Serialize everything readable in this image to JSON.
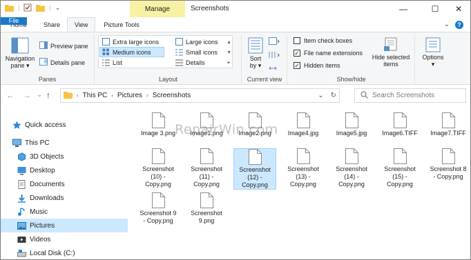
{
  "window": {
    "title": "Screenshots",
    "contextual_tab_group": "Manage",
    "controls": {
      "minimize": "—",
      "maximize": "☐",
      "close": "✕"
    }
  },
  "tabs": [
    {
      "label": "File"
    },
    {
      "label": "Home"
    },
    {
      "label": "Share"
    },
    {
      "label": "View"
    },
    {
      "label": "Picture Tools"
    }
  ],
  "tab_right": {
    "expand": "⌄",
    "help": "?"
  },
  "ribbon": {
    "panes": {
      "label": "Panes",
      "navigation_pane_line1": "Navigation",
      "navigation_pane_line2": "pane ▾",
      "preview_pane": "Preview pane",
      "details_pane": "Details pane"
    },
    "layout": {
      "label": "Layout",
      "items": [
        {
          "label": "Extra large icons"
        },
        {
          "label": "Large icons"
        },
        {
          "label": "Medium icons"
        },
        {
          "label": "Small icons"
        },
        {
          "label": "List"
        },
        {
          "label": "Details"
        }
      ]
    },
    "current_view": {
      "label": "Current view",
      "sort_line1": "Sort",
      "sort_line2": "by ▾"
    },
    "show_hide": {
      "label": "Show/hide",
      "item_check_boxes": {
        "label": "Item check boxes",
        "checked": false
      },
      "file_name_extensions": {
        "label": "File name extensions",
        "checked": true
      },
      "hidden_items": {
        "label": "Hidden items",
        "checked": true
      },
      "hide_selected_line1": "Hide selected",
      "hide_selected_line2": "items"
    },
    "options": {
      "label": "Options",
      "caret": "▾"
    }
  },
  "address": {
    "back": "←",
    "forward": "→",
    "down": "⌄",
    "up": "↑",
    "crumbs": [
      "This PC",
      "Pictures",
      "Screenshots"
    ],
    "separator": "›",
    "dropdown": "⌄",
    "refresh": "↻"
  },
  "search": {
    "placeholder": "Search Screenshots"
  },
  "nav": {
    "items": [
      {
        "label": "Quick access",
        "icon": "star-icon",
        "selected": false
      },
      {
        "label": "This PC",
        "icon": "computer-icon",
        "selected": false
      },
      {
        "label": "3D Objects",
        "icon": "cube-icon",
        "selected": false
      },
      {
        "label": "Desktop",
        "icon": "desktop-icon",
        "selected": false
      },
      {
        "label": "Documents",
        "icon": "documents-icon",
        "selected": false
      },
      {
        "label": "Downloads",
        "icon": "download-icon",
        "selected": false
      },
      {
        "label": "Music",
        "icon": "music-icon",
        "selected": false
      },
      {
        "label": "Pictures",
        "icon": "pictures-icon",
        "selected": true
      },
      {
        "label": "Videos",
        "icon": "video-icon",
        "selected": false
      },
      {
        "label": "Local Disk (C:)",
        "icon": "disk-icon",
        "selected": false
      }
    ]
  },
  "files": [
    {
      "name": "Image 3.png",
      "selected": false
    },
    {
      "name": "Image1.png",
      "selected": false
    },
    {
      "name": "Image2.png",
      "selected": false
    },
    {
      "name": "Image4.jpg",
      "selected": false
    },
    {
      "name": "Image5.jpg",
      "selected": false
    },
    {
      "name": "Image6.TIFF",
      "selected": false
    },
    {
      "name": "Image7.TIFF",
      "selected": false
    },
    {
      "name": "Screenshot (10) - Copy.png",
      "selected": false
    },
    {
      "name": "Screenshot (11) - Copy.png",
      "selected": false
    },
    {
      "name": "Screenshot (12) - Copy.png",
      "selected": true
    },
    {
      "name": "Screenshot (13) - Copy.png",
      "selected": false
    },
    {
      "name": "Screenshot (14) - Copy.png",
      "selected": false
    },
    {
      "name": "Screenshot (15) - Copy.png",
      "selected": false
    },
    {
      "name": "Screenshot 8 - Copy.png",
      "selected": false
    },
    {
      "name": "Screenshot 9 - Copy.png",
      "selected": false
    },
    {
      "name": "Screenshot 9.png",
      "selected": false
    }
  ],
  "watermark": "RepairWin.com",
  "colors": {
    "file_tab": "#1979ca",
    "manage_band": "#f8f1a3",
    "selection": "#cce8ff",
    "selection_border": "#99d1ff",
    "ribbon_bg": "#f5f6f7"
  }
}
